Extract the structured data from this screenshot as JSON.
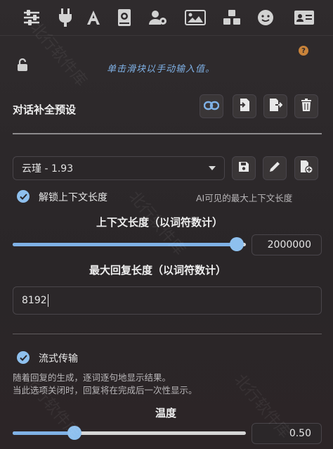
{
  "toolbar": {
    "icons": [
      "sliders-icon",
      "plug-icon",
      "font-icon",
      "book-icon",
      "user-cog-icon",
      "image-icon",
      "cubes-icon",
      "face-icon",
      "id-card-icon"
    ]
  },
  "top": {
    "hint": "单击滑块以手动输入值。",
    "help_glyph": "?"
  },
  "preset": {
    "title": "对话补全预设",
    "selected": "云瑾 - 1.93"
  },
  "context": {
    "unlock_label": "解锁上下文长度",
    "ai_visible_label": "AI可见的最大上下文长度",
    "context_title": "上下文长度（以词符数计）",
    "context_value": "2000000",
    "context_fraction": 0.99,
    "max_reply_title": "最大回复长度（以词符数计）",
    "max_reply_value": "8192"
  },
  "streaming": {
    "label": "流式传输",
    "desc1": "随着回复的生成，逐词逐句地显示结果。",
    "desc2": "当此选项关闭时，回复将在完成后一次性显示。"
  },
  "temperature": {
    "title": "温度",
    "value": "0.50",
    "fraction": 0.25
  },
  "watermark": "北行软件库",
  "colors": {
    "accent": "#7fb1e6",
    "check": "#8ec0ee",
    "help": "#c9833a"
  }
}
